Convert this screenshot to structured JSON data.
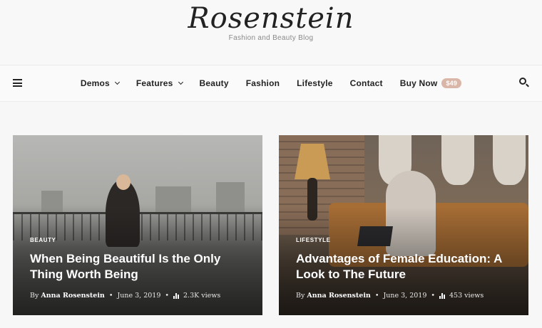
{
  "header": {
    "logo": "Rosenstein",
    "tagline": "Fashion and Beauty Blog"
  },
  "nav": {
    "items": [
      {
        "label": "Demos",
        "dropdown": true
      },
      {
        "label": "Features",
        "dropdown": true
      },
      {
        "label": "Beauty",
        "dropdown": false
      },
      {
        "label": "Fashion",
        "dropdown": false
      },
      {
        "label": "Lifestyle",
        "dropdown": false
      },
      {
        "label": "Contact",
        "dropdown": false
      },
      {
        "label": "Buy Now",
        "dropdown": false
      }
    ],
    "buy_badge": "$49",
    "icons": {
      "menu": "hamburger-icon",
      "search": "search-icon"
    }
  },
  "posts": [
    {
      "category": "BEAUTY",
      "title": "When Being Beautiful Is the Only Thing Worth Being",
      "by": "By",
      "author": "Anna Rosenstein",
      "date": "June 3, 2019",
      "views": "2.3K views"
    },
    {
      "category": "LIFESTYLE",
      "title": "Advantages of Female Education: A Look to The Future",
      "by": "By",
      "author": "Anna Rosenstein",
      "date": "June 3, 2019",
      "views": "453 views"
    }
  ],
  "colors": {
    "badge": "#d9b6a8",
    "text": "#222222",
    "background": "#f7f7f7"
  }
}
